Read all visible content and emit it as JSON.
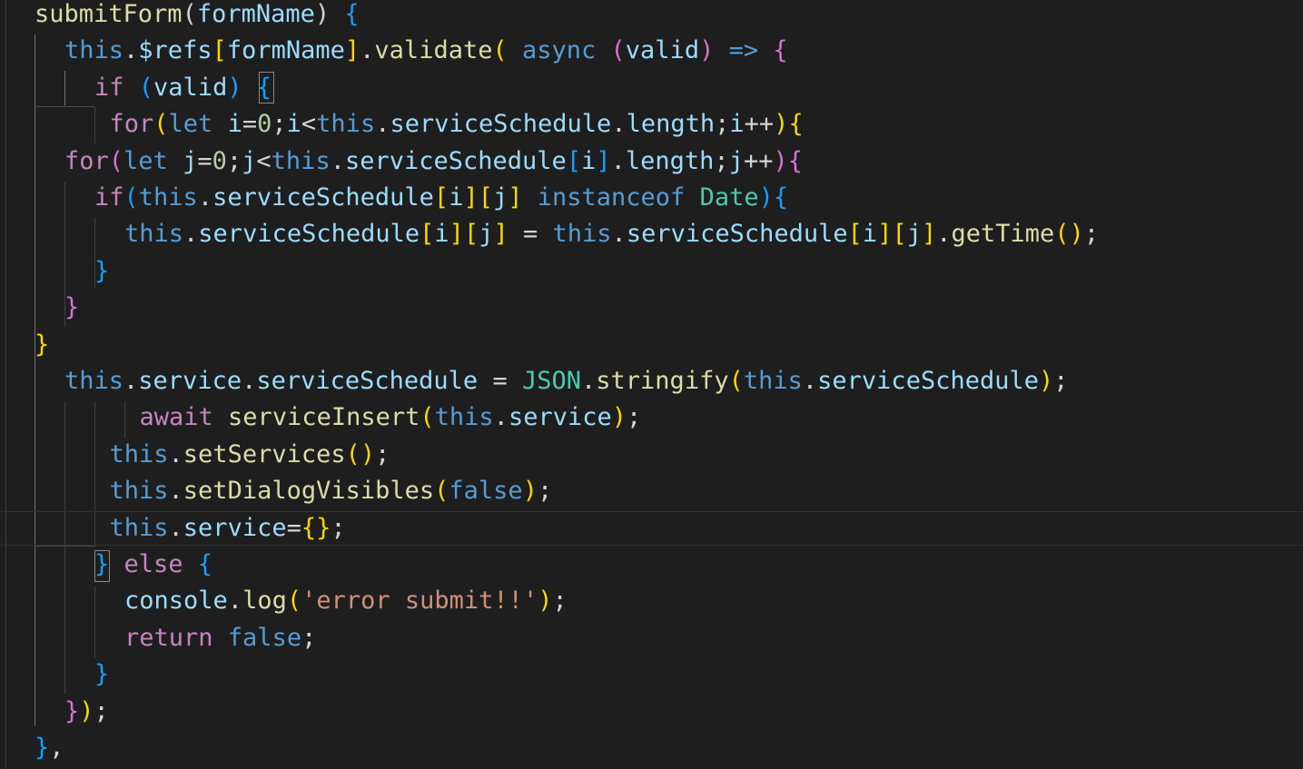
{
  "editor": {
    "language": "javascript",
    "theme_background": "#1e1e1e",
    "lines": [
      {
        "indent": 0,
        "tokens": [
          {
            "t": "submitForm",
            "c": "fn"
          },
          {
            "t": "(",
            "c": "op"
          },
          {
            "t": "formName",
            "c": "var"
          },
          {
            "t": ") ",
            "c": "op"
          },
          {
            "t": "{",
            "c": "b3"
          }
        ]
      },
      {
        "indent": 1,
        "tokens": [
          {
            "t": "this",
            "c": "kw"
          },
          {
            "t": ".",
            "c": "op"
          },
          {
            "t": "$refs",
            "c": "var"
          },
          {
            "t": "[",
            "c": "b1"
          },
          {
            "t": "formName",
            "c": "var"
          },
          {
            "t": "]",
            "c": "b1"
          },
          {
            "t": ".",
            "c": "op"
          },
          {
            "t": "validate",
            "c": "fn"
          },
          {
            "t": "( ",
            "c": "b1"
          },
          {
            "t": "async ",
            "c": "kw"
          },
          {
            "t": "(",
            "c": "b2"
          },
          {
            "t": "valid",
            "c": "var"
          },
          {
            "t": ") ",
            "c": "b2"
          },
          {
            "t": "=> ",
            "c": "kw"
          },
          {
            "t": "{",
            "c": "b2"
          }
        ]
      },
      {
        "indent": 2,
        "tokens": [
          {
            "t": "if ",
            "c": "ctl"
          },
          {
            "t": "(",
            "c": "b3"
          },
          {
            "t": "valid",
            "c": "var"
          },
          {
            "t": ") ",
            "c": "b3"
          },
          {
            "t": "{",
            "c": "b3"
          }
        ]
      },
      {
        "indent": 2.5,
        "tokens": [
          {
            "t": "for",
            "c": "ctl"
          },
          {
            "t": "(",
            "c": "b1"
          },
          {
            "t": "let ",
            "c": "kw"
          },
          {
            "t": "i",
            "c": "var"
          },
          {
            "t": "=",
            "c": "op"
          },
          {
            "t": "0",
            "c": "num"
          },
          {
            "t": ";",
            "c": "op"
          },
          {
            "t": "i",
            "c": "var"
          },
          {
            "t": "<",
            "c": "op"
          },
          {
            "t": "this",
            "c": "kw"
          },
          {
            "t": ".",
            "c": "op"
          },
          {
            "t": "serviceSchedule",
            "c": "var"
          },
          {
            "t": ".",
            "c": "op"
          },
          {
            "t": "length",
            "c": "var"
          },
          {
            "t": ";",
            "c": "op"
          },
          {
            "t": "i",
            "c": "var"
          },
          {
            "t": "++",
            "c": "op"
          },
          {
            "t": ")",
            "c": "b1"
          },
          {
            "t": "{",
            "c": "b1"
          }
        ]
      },
      {
        "indent": 1,
        "tokens": [
          {
            "t": "for",
            "c": "ctl"
          },
          {
            "t": "(",
            "c": "b2"
          },
          {
            "t": "let ",
            "c": "kw"
          },
          {
            "t": "j",
            "c": "var"
          },
          {
            "t": "=",
            "c": "op"
          },
          {
            "t": "0",
            "c": "num"
          },
          {
            "t": ";",
            "c": "op"
          },
          {
            "t": "j",
            "c": "var"
          },
          {
            "t": "<",
            "c": "op"
          },
          {
            "t": "this",
            "c": "kw"
          },
          {
            "t": ".",
            "c": "op"
          },
          {
            "t": "serviceSchedule",
            "c": "var"
          },
          {
            "t": "[",
            "c": "b3"
          },
          {
            "t": "i",
            "c": "var"
          },
          {
            "t": "]",
            "c": "b3"
          },
          {
            "t": ".",
            "c": "op"
          },
          {
            "t": "length",
            "c": "var"
          },
          {
            "t": ";",
            "c": "op"
          },
          {
            "t": "j",
            "c": "var"
          },
          {
            "t": "++",
            "c": "op"
          },
          {
            "t": ")",
            "c": "b2"
          },
          {
            "t": "{",
            "c": "b2"
          }
        ]
      },
      {
        "indent": 2,
        "tokens": [
          {
            "t": "if",
            "c": "ctl"
          },
          {
            "t": "(",
            "c": "b3"
          },
          {
            "t": "this",
            "c": "kw"
          },
          {
            "t": ".",
            "c": "op"
          },
          {
            "t": "serviceSchedule",
            "c": "var"
          },
          {
            "t": "[",
            "c": "b1"
          },
          {
            "t": "i",
            "c": "var"
          },
          {
            "t": "]",
            "c": "b1"
          },
          {
            "t": "[",
            "c": "b1"
          },
          {
            "t": "j",
            "c": "var"
          },
          {
            "t": "] ",
            "c": "b1"
          },
          {
            "t": "instanceof ",
            "c": "kw"
          },
          {
            "t": "Date",
            "c": "cls"
          },
          {
            "t": ")",
            "c": "b3"
          },
          {
            "t": "{",
            "c": "b3"
          }
        ]
      },
      {
        "indent": 3,
        "tokens": [
          {
            "t": "this",
            "c": "kw"
          },
          {
            "t": ".",
            "c": "op"
          },
          {
            "t": "serviceSchedule",
            "c": "var"
          },
          {
            "t": "[",
            "c": "b1"
          },
          {
            "t": "i",
            "c": "var"
          },
          {
            "t": "]",
            "c": "b1"
          },
          {
            "t": "[",
            "c": "b1"
          },
          {
            "t": "j",
            "c": "var"
          },
          {
            "t": "]",
            "c": "b1"
          },
          {
            "t": " = ",
            "c": "op"
          },
          {
            "t": "this",
            "c": "kw"
          },
          {
            "t": ".",
            "c": "op"
          },
          {
            "t": "serviceSchedule",
            "c": "var"
          },
          {
            "t": "[",
            "c": "b1"
          },
          {
            "t": "i",
            "c": "var"
          },
          {
            "t": "]",
            "c": "b1"
          },
          {
            "t": "[",
            "c": "b1"
          },
          {
            "t": "j",
            "c": "var"
          },
          {
            "t": "]",
            "c": "b1"
          },
          {
            "t": ".",
            "c": "op"
          },
          {
            "t": "getTime",
            "c": "fn"
          },
          {
            "t": "()",
            "c": "b1"
          },
          {
            "t": ";",
            "c": "op"
          }
        ]
      },
      {
        "indent": 2,
        "tokens": [
          {
            "t": "}",
            "c": "b3"
          }
        ]
      },
      {
        "indent": 1,
        "tokens": [
          {
            "t": "}",
            "c": "b2"
          }
        ]
      },
      {
        "indent": 0,
        "tokens": [
          {
            "t": "}",
            "c": "b1"
          }
        ]
      },
      {
        "indent": 1,
        "tokens": [
          {
            "t": "this",
            "c": "kw"
          },
          {
            "t": ".",
            "c": "op"
          },
          {
            "t": "service",
            "c": "var"
          },
          {
            "t": ".",
            "c": "op"
          },
          {
            "t": "serviceSchedule",
            "c": "var"
          },
          {
            "t": " = ",
            "c": "op"
          },
          {
            "t": "JSON",
            "c": "cls"
          },
          {
            "t": ".",
            "c": "op"
          },
          {
            "t": "stringify",
            "c": "fn"
          },
          {
            "t": "(",
            "c": "b1"
          },
          {
            "t": "this",
            "c": "kw"
          },
          {
            "t": ".",
            "c": "op"
          },
          {
            "t": "serviceSchedule",
            "c": "var"
          },
          {
            "t": ")",
            "c": "b1"
          },
          {
            "t": ";",
            "c": "op"
          }
        ]
      },
      {
        "indent": 3.5,
        "tokens": [
          {
            "t": "await ",
            "c": "ctl"
          },
          {
            "t": "serviceInsert",
            "c": "fn"
          },
          {
            "t": "(",
            "c": "b1"
          },
          {
            "t": "this",
            "c": "kw"
          },
          {
            "t": ".",
            "c": "op"
          },
          {
            "t": "service",
            "c": "var"
          },
          {
            "t": ")",
            "c": "b1"
          },
          {
            "t": ";",
            "c": "op"
          }
        ]
      },
      {
        "indent": 2.5,
        "tokens": [
          {
            "t": "this",
            "c": "kw"
          },
          {
            "t": ".",
            "c": "op"
          },
          {
            "t": "setServices",
            "c": "fn"
          },
          {
            "t": "()",
            "c": "b1"
          },
          {
            "t": ";",
            "c": "op"
          }
        ]
      },
      {
        "indent": 2.5,
        "tokens": [
          {
            "t": "this",
            "c": "kw"
          },
          {
            "t": ".",
            "c": "op"
          },
          {
            "t": "setDialogVisibles",
            "c": "fn"
          },
          {
            "t": "(",
            "c": "b1"
          },
          {
            "t": "false",
            "c": "kw"
          },
          {
            "t": ")",
            "c": "b1"
          },
          {
            "t": ";",
            "c": "op"
          }
        ]
      },
      {
        "indent": 2.5,
        "tokens": [
          {
            "t": "this",
            "c": "kw"
          },
          {
            "t": ".",
            "c": "op"
          },
          {
            "t": "service",
            "c": "var"
          },
          {
            "t": "=",
            "c": "op"
          },
          {
            "t": "{}",
            "c": "b1"
          },
          {
            "t": ";",
            "c": "op"
          }
        ]
      },
      {
        "indent": 2,
        "tokens": [
          {
            "t": "} ",
            "c": "b3"
          },
          {
            "t": "else ",
            "c": "ctl"
          },
          {
            "t": "{",
            "c": "b3"
          }
        ]
      },
      {
        "indent": 3,
        "tokens": [
          {
            "t": "console",
            "c": "var"
          },
          {
            "t": ".",
            "c": "op"
          },
          {
            "t": "log",
            "c": "fn"
          },
          {
            "t": "(",
            "c": "b1"
          },
          {
            "t": "'error submit!!'",
            "c": "str"
          },
          {
            "t": ")",
            "c": "b1"
          },
          {
            "t": ";",
            "c": "op"
          }
        ]
      },
      {
        "indent": 3,
        "tokens": [
          {
            "t": "return ",
            "c": "ctl"
          },
          {
            "t": "false",
            "c": "kw"
          },
          {
            "t": ";",
            "c": "op"
          }
        ]
      },
      {
        "indent": 2,
        "tokens": [
          {
            "t": "}",
            "c": "b3"
          }
        ]
      },
      {
        "indent": 1,
        "tokens": [
          {
            "t": "}",
            "c": "b2"
          },
          {
            "t": ")",
            "c": "b1"
          },
          {
            "t": ";",
            "c": "op"
          }
        ]
      },
      {
        "indent": 0,
        "tokens": [
          {
            "t": "}",
            "c": "b3"
          },
          {
            "t": ",",
            "c": "op"
          }
        ]
      }
    ]
  }
}
